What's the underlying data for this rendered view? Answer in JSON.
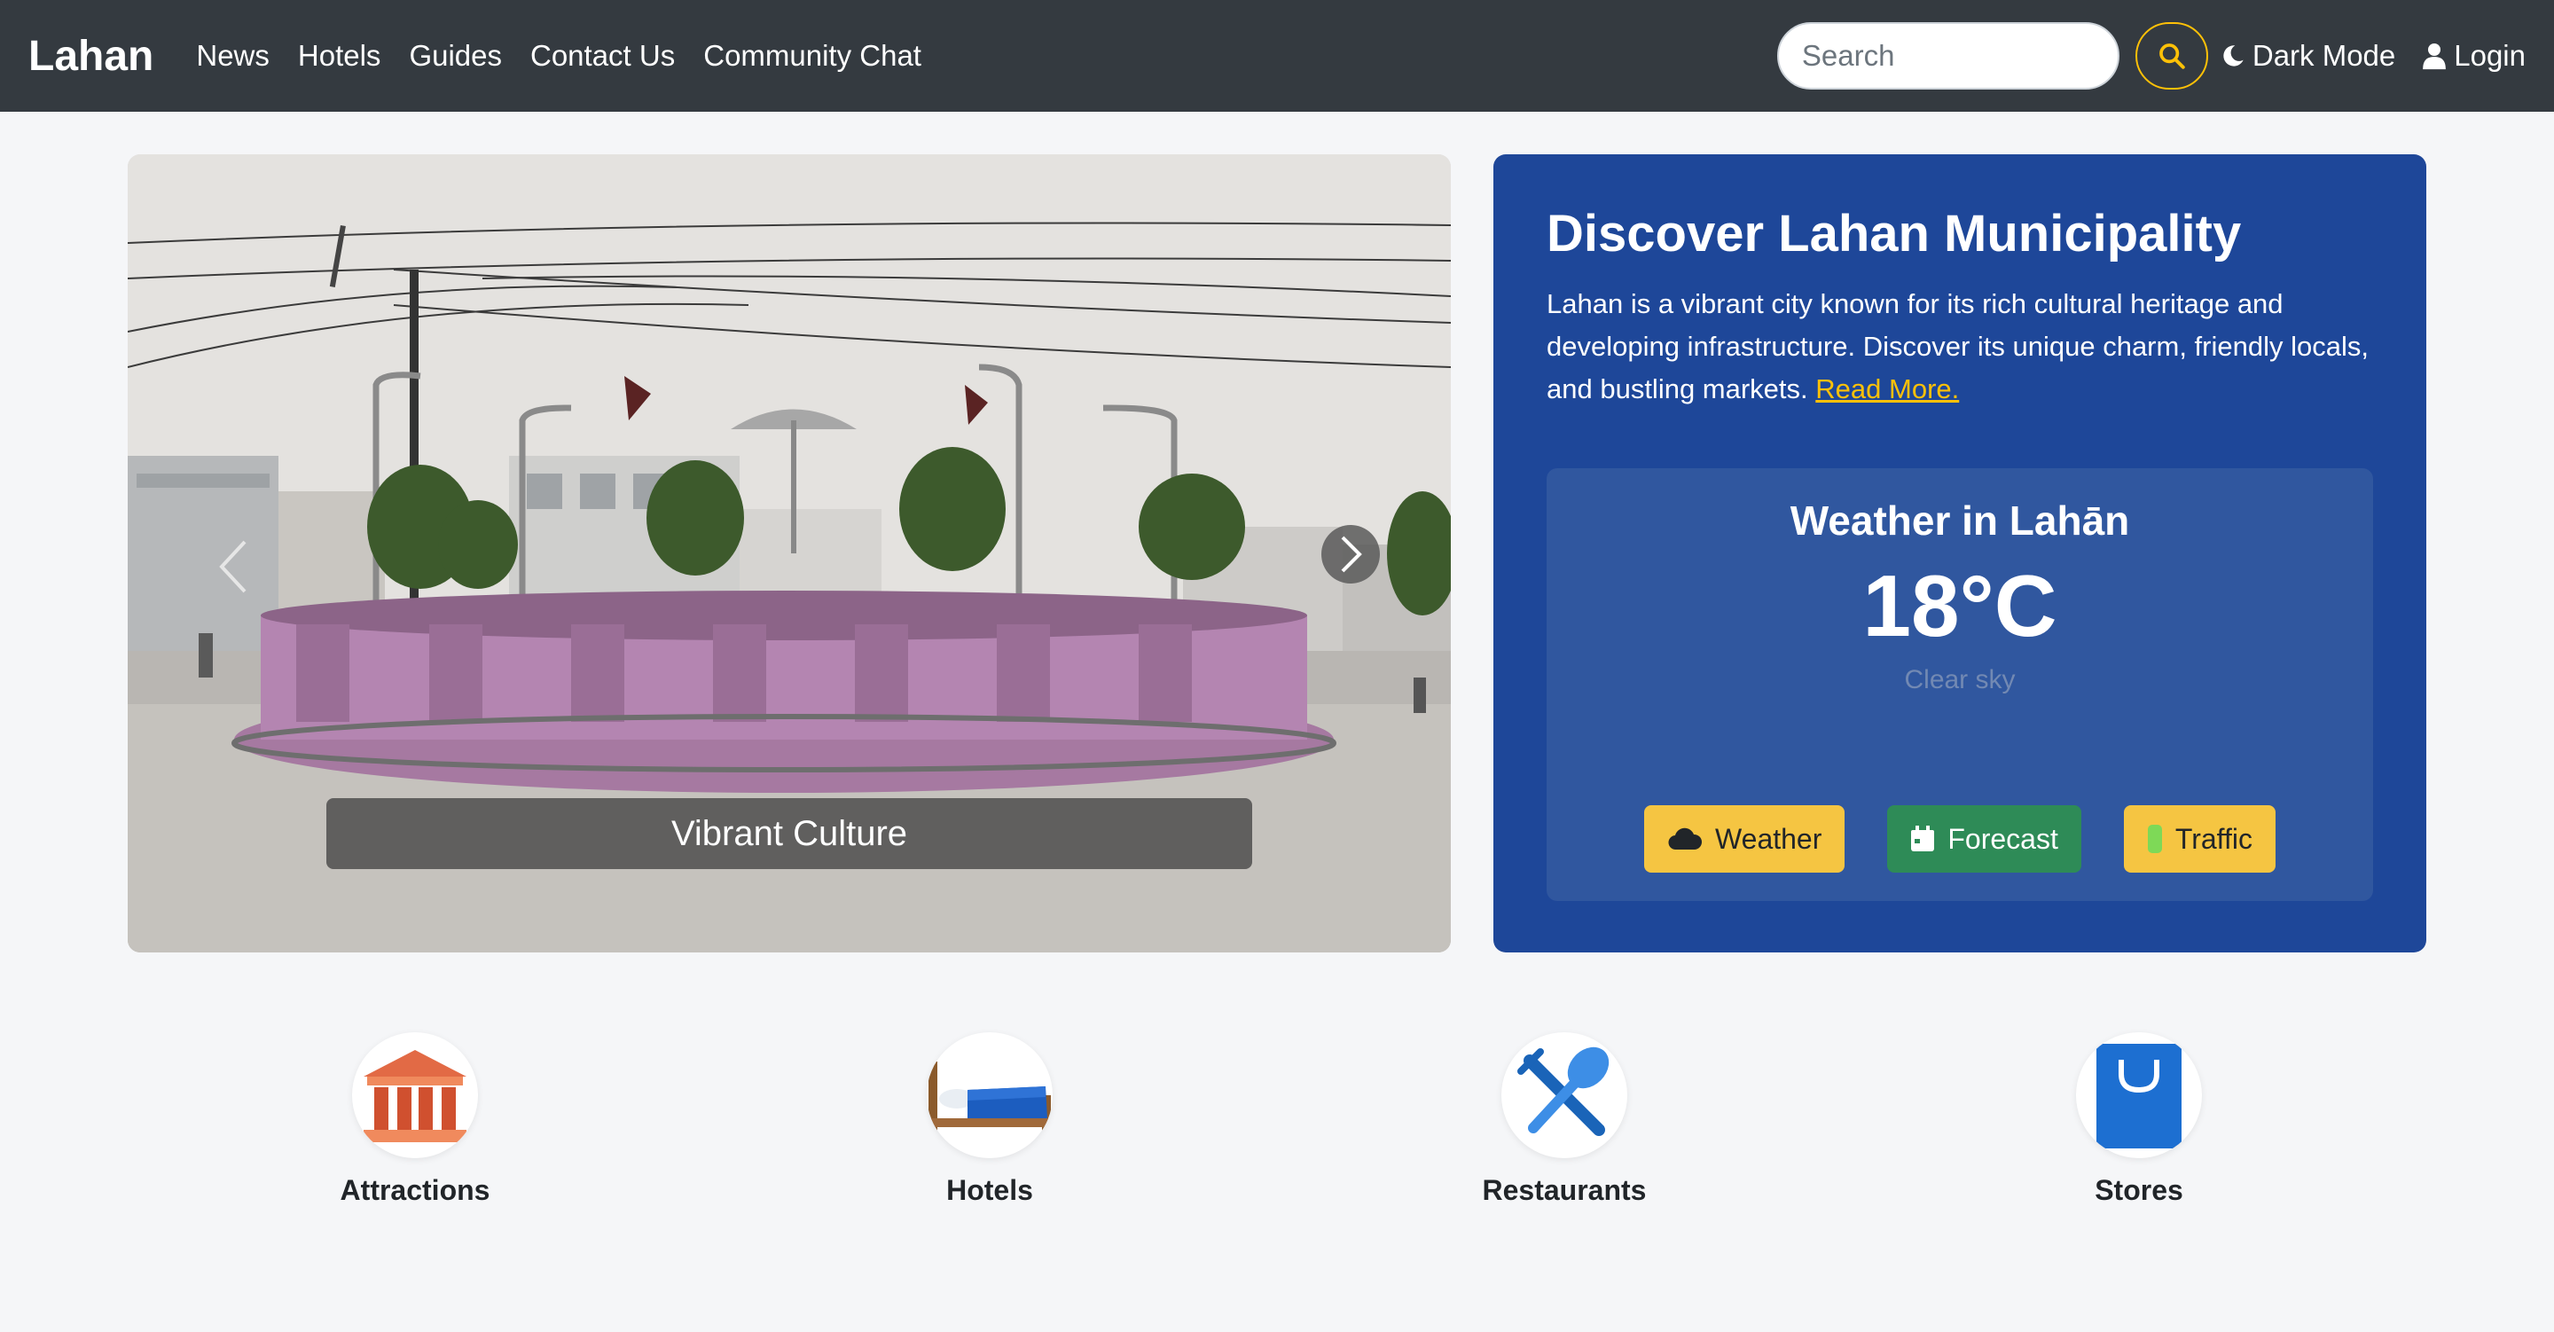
{
  "navbar": {
    "brand": "Lahan",
    "links": [
      "News",
      "Hotels",
      "Guides",
      "Contact Us",
      "Community Chat"
    ],
    "search_placeholder": "Search",
    "dark_mode_label": "Dark Mode",
    "login_label": "Login",
    "accent_color": "#ffc107"
  },
  "carousel": {
    "caption": "Vibrant Culture"
  },
  "discover": {
    "title": "Discover Lahan Municipality",
    "description": "Lahan is a vibrant city known for its rich cultural heritage and developing infrastructure. Discover its unique charm, friendly locals, and bustling markets.",
    "read_more": "Read More.",
    "background_color": "#1e4799"
  },
  "weather": {
    "title": "Weather in Lahān",
    "temperature": "18°C",
    "condition": "Clear sky",
    "buttons": {
      "weather": "Weather",
      "forecast": "Forecast",
      "traffic": "Traffic"
    }
  },
  "categories": [
    {
      "label": "Attractions",
      "icon": "classical-building-icon"
    },
    {
      "label": "Hotels",
      "icon": "bed-icon"
    },
    {
      "label": "Restaurants",
      "icon": "fork-spoon-icon"
    },
    {
      "label": "Stores",
      "icon": "shopping-bag-icon"
    }
  ]
}
